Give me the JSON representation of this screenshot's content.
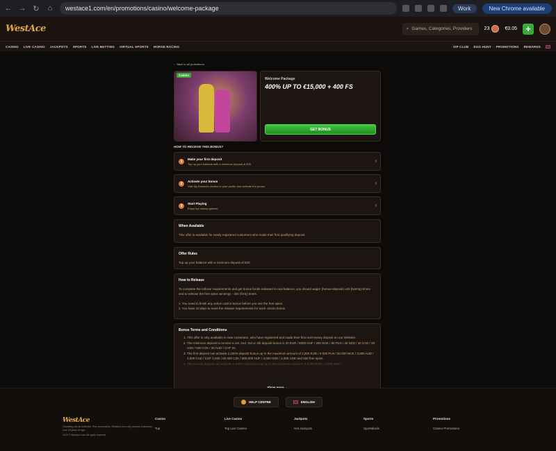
{
  "browser": {
    "url": "westace1.com/en/promotions/casino/welcome-package",
    "work_label": "Work",
    "update_label": "New Chrome available"
  },
  "header": {
    "logo": "WestAce",
    "search_placeholder": "Games, Categories, Providers",
    "coins": "23",
    "balance": "€0.05",
    "plus": "+"
  },
  "nav": {
    "left": [
      "CASINO",
      "LIVE CASINO",
      "JACKPOTS",
      "SPORTS",
      "LIVE BETTING",
      "VIRTUAL SPORTS",
      "HORSE RACING"
    ],
    "right": [
      "VIP CLUB",
      "EGG HUNT",
      "PROMOTIONS",
      "REWARDS"
    ]
  },
  "page": {
    "back": "Back to all promotions",
    "badge": "Casino",
    "subtitle": "Welcome Package",
    "title": "400% UP TO €15,000 + 400 FS",
    "cta": "GET BONUS",
    "how_title": "HOW TO RECEIVE THIS BONUS?",
    "steps": [
      {
        "num": "1",
        "title": "Make your first deposit",
        "desc": "Top up your balance with a minimum deposit of €20"
      },
      {
        "num": "2",
        "title": "Activate your bonus",
        "desc": "Visit My Bonuses section in your profile and activate the promo"
      },
      {
        "num": "3",
        "title": "Start Playing",
        "desc": "Enjoy top casino games!"
      }
    ],
    "when_title": "When Available",
    "when_text": "This offer is available for newly registered customers who made their first qualifying deposit.",
    "rules_title": "Offer Rules",
    "rules_text": "Top up your balance with a minimum deposit of €20.",
    "release_title": "How to Release",
    "release_text": "To complete the rollover requirements and get bonus funds released to real balance, you should wager (bonus+deposit) x20 (twenty) times and to release the free spins winnings - 40x (forty) times.",
    "release_line1": "1. You need to finish any active casino bonus before you use the free spins.",
    "release_line2": "2. You have 10 days to meet the release requirements for each casino bonus.",
    "terms_title": "Bonus Terms and Conditions",
    "terms": [
      "This offer is only available to new customers, who have registered and made their first real-money deposit on our Website.",
      "The minimum deposit to receive a 1st, 2nd, 3rd or 4th deposit bonus is 20 EUR / 6000 HUF / 200 NOK / 90 PLN / 40 NZD / 30 CAD / 20 USD / 500 CZK / 30 AUD / CHF 22.",
      "The first deposit can activate a 100% deposit bonus up to the maximum amount of 2,000 EUR / 9 000 PLN / 20 000 NOK / 3,000 AUD / 3,000 CAD / CHF 2,200 / 50 000 CZK / 800.000 HUF / 4,000 NZD / 2,000 USD and 150 free spins.",
      "The second deposit can activate a 100% deposit bonus up to the maximum amount of 3,000 EUR / 3,000 USD /"
    ],
    "show_more": "Show more"
  },
  "footer": {
    "help": "HELP CENTRE",
    "lang": "ENGLISH",
    "disclaimer": "Gambling can be addictive. Play responsibly. Westace.com only accepts customers over 18 years of age.",
    "copyright": "2025 © Westace.com All rights reserved.",
    "cols": [
      {
        "title": "Casino",
        "sub": "Top"
      },
      {
        "title": "Live Casino",
        "sub": "Top Live Casino"
      },
      {
        "title": "Jackpots",
        "sub": "Hot Jackpots"
      },
      {
        "title": "Sports",
        "sub": "Sportsbook"
      },
      {
        "title": "Promotions",
        "sub": "Casino Promotions"
      }
    ]
  }
}
